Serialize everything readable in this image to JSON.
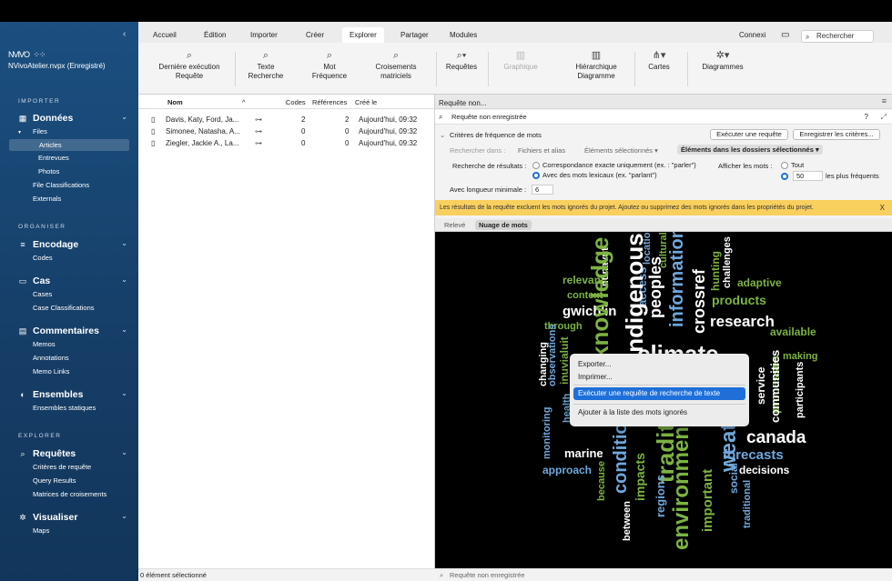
{
  "app": {
    "logo": "NVIVO",
    "project": "NVivoAtelier.nvpx (Enregistré)"
  },
  "sidebar": {
    "sections": {
      "import": "IMPORTER",
      "organize": "ORGANISER",
      "explore": "EXPLORER"
    },
    "donnees": {
      "label": "Données",
      "files": "Files",
      "articles": "Articles",
      "entrevues": "Entrevues",
      "photos": "Photos",
      "file_classifications": "File Classifications",
      "externals": "Externals"
    },
    "encodage": {
      "label": "Encodage",
      "codes": "Codes"
    },
    "cas": {
      "label": "Cas",
      "cases": "Cases",
      "case_classifications": "Case Classifications"
    },
    "commentaires": {
      "label": "Commentaires",
      "memos": "Memos",
      "annotations": "Annotations",
      "memo_links": "Memo Links"
    },
    "ensembles": {
      "label": "Ensembles",
      "statiques": "Ensembles statiques"
    },
    "requetes": {
      "label": "Requêtes",
      "criteres": "Critères de requête",
      "query_results": "Query Results",
      "matrices": "Matrices de croisements"
    },
    "visualiser": {
      "label": "Visualiser",
      "maps": "Maps"
    }
  },
  "menu_tabs": [
    "Accueil",
    "Édition",
    "Importer",
    "Créer",
    "Explorer",
    "Partager",
    "Modules"
  ],
  "active_tab": "Explorer",
  "header_right": {
    "connect": "Connexi",
    "search_placeholder": "Rechercher"
  },
  "ribbon": {
    "last_run": "Dernière exécution Requête",
    "text_search": "Texte Recherche",
    "word_freq": "Mot Fréquence",
    "matrix": "Croisements matriciels",
    "queries": "Requêtes",
    "chart": "Graphique",
    "hierarchy": "Hiérarchique Diagramme",
    "maps": "Cartes",
    "diagrams": "Diagrammes"
  },
  "filelist": {
    "columns": {
      "name": "Nom",
      "codes": "Codes",
      "refs": "Références",
      "created": "Créé le"
    },
    "rows": [
      {
        "name": "Davis, Katy, Ford, Ja...",
        "codes": "2",
        "refs": "2",
        "created": "Aujourd'hui, 09:32"
      },
      {
        "name": "Simonee, Natasha, A...",
        "codes": "0",
        "refs": "0",
        "created": "Aujourd'hui, 09:32"
      },
      {
        "name": "Ziegler, Jackie A., La...",
        "codes": "0",
        "refs": "0",
        "created": "Aujourd'hui, 09:32"
      }
    ],
    "status": "0 élément sélectionné"
  },
  "query": {
    "tab_label": "Requête non...",
    "name": "Requête non enregistrée",
    "help": "?",
    "criteria_title": "Critères de fréquence de mots",
    "run_button": "Exécuter une requête",
    "save_button": "Enregistrer les critères...",
    "search_in_label": "Rechercher dans :",
    "files_memos": "Fichiers et alias",
    "selected_items": "Éléments sélectionnés",
    "in_folders": "Éléments dans les dossiers sélectionnés",
    "results_label": "Recherche de résultats :",
    "exact_match": "Correspondance exacte uniquement (ex. : \"parler\")",
    "stemmed": "Avec des mots lexicaux (ex. \"parlant\")",
    "display_words_label": "Afficher les mots :",
    "all": "Tout",
    "top_count": "50",
    "most_frequent": "les plus fréquents",
    "min_length_label": "Avec longueur minimale :",
    "min_length": "6",
    "notice": "Les résultats de la requête excluent les mots ignorés du projet. Ajoutez ou supprimez des mots ignorés dans les propriétés du projet.",
    "notice_close": "X",
    "result_tabs": [
      "Relevé",
      "Nuage de mots"
    ],
    "active_result_tab": "Nuage de mots",
    "status": "Requête non enregistrée"
  },
  "context_menu": {
    "export": "Exporter...",
    "print": "Imprimer...",
    "run_text_search": "Exécuter une requête de recherche de texte",
    "add_stop": "Ajouter à la liste des mots ignorés"
  },
  "colors": {
    "sidebar": "#1b4f80",
    "accent": "#1e6fd9",
    "green": "#7cb342",
    "blue": "#6fa8dc",
    "white": "#ffffff",
    "notice": "#f9cf5e"
  },
  "wordcloud": [
    {
      "text": "relevant",
      "color": "#7cb342"
    },
    {
      "text": "context",
      "color": "#7cb342"
    },
    {
      "text": "gwich'in",
      "color": "#ffffff"
    },
    {
      "text": "through",
      "color": "#7cb342"
    },
    {
      "text": "nunavut",
      "color": "#ffffff"
    },
    {
      "text": "access",
      "color": "#6fa8dc"
    },
    {
      "text": "peoples",
      "color": "#ffffff"
    },
    {
      "text": "location",
      "color": "#6fa8dc"
    },
    {
      "text": "cultural",
      "color": "#7cb342"
    },
    {
      "text": "information",
      "color": "#6fa8dc"
    },
    {
      "text": "crossref",
      "color": "#ffffff"
    },
    {
      "text": "hunting",
      "color": "#7cb342"
    },
    {
      "text": "challenges",
      "color": "#ffffff"
    },
    {
      "text": "adaptive",
      "color": "#7cb342"
    },
    {
      "text": "products",
      "color": "#7cb342"
    },
    {
      "text": "research",
      "color": "#ffffff"
    },
    {
      "text": "available",
      "color": "#7cb342"
    },
    {
      "text": "making",
      "color": "#7cb342"
    },
    {
      "text": "indigenous",
      "color": "#ffffff"
    },
    {
      "text": "climate",
      "color": "#ffffff"
    },
    {
      "text": "knowledge",
      "color": "#7cb342"
    },
    {
      "text": "observations",
      "color": "#6fa8dc"
    },
    {
      "text": "inuvialuit",
      "color": "#7cb342"
    },
    {
      "text": "changing",
      "color": "#ffffff"
    },
    {
      "text": "health",
      "color": "#6fa8dc"
    },
    {
      "text": "monitoring",
      "color": "#6fa8dc"
    },
    {
      "text": "service",
      "color": "#ffffff"
    },
    {
      "text": "processes",
      "color": "#7cb342"
    },
    {
      "text": "communities",
      "color": "#ffffff"
    },
    {
      "text": "participants",
      "color": "#ffffff"
    },
    {
      "text": "canada",
      "color": "#ffffff"
    },
    {
      "text": "forecasts",
      "color": "#6fa8dc"
    },
    {
      "text": "marine",
      "color": "#ffffff"
    },
    {
      "text": "approach",
      "color": "#6fa8dc"
    },
    {
      "text": "conditions",
      "color": "#6fa8dc"
    },
    {
      "text": "traditional",
      "color": "#7cb342"
    },
    {
      "text": "weather",
      "color": "#6fa8dc"
    },
    {
      "text": "decisions",
      "color": "#ffffff"
    },
    {
      "text": "because",
      "color": "#7cb342"
    },
    {
      "text": "impacts",
      "color": "#7cb342"
    },
    {
      "text": "regions",
      "color": "#6fa8dc"
    },
    {
      "text": "environment",
      "color": "#7cb342"
    },
    {
      "text": "important",
      "color": "#7cb342"
    },
    {
      "text": "social",
      "color": "#6fa8dc"
    },
    {
      "text": "traditional",
      "color": "#6fa8dc"
    },
    {
      "text": "between",
      "color": "#ffffff"
    }
  ]
}
